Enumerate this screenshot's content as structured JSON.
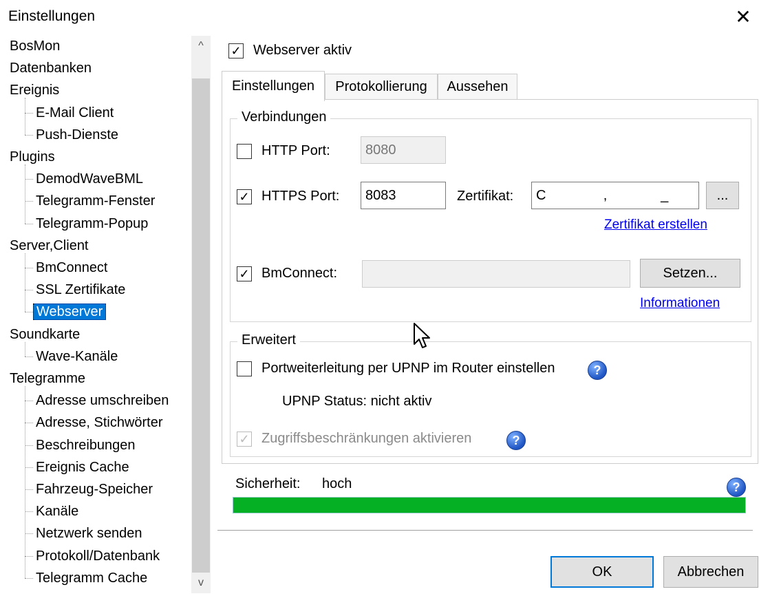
{
  "window": {
    "title": "Einstellungen",
    "close_symbol": "✕"
  },
  "tree": {
    "items": [
      {
        "label": "BosMon",
        "level": 0
      },
      {
        "label": "Datenbanken",
        "level": 0
      },
      {
        "label": "Ereignis",
        "level": 0
      },
      {
        "label": "E-Mail Client",
        "level": 1
      },
      {
        "label": "Push-Dienste",
        "level": 1
      },
      {
        "label": "Plugins",
        "level": 0
      },
      {
        "label": "DemodWaveBML",
        "level": 1
      },
      {
        "label": "Telegramm-Fenster",
        "level": 1
      },
      {
        "label": "Telegramm-Popup",
        "level": 1
      },
      {
        "label": "Server,Client",
        "level": 0
      },
      {
        "label": "BmConnect",
        "level": 1
      },
      {
        "label": "SSL Zertifikate",
        "level": 1
      },
      {
        "label": "Webserver",
        "level": 1,
        "selected": true
      },
      {
        "label": "Soundkarte",
        "level": 0
      },
      {
        "label": "Wave-Kanäle",
        "level": 1
      },
      {
        "label": "Telegramme",
        "level": 0
      },
      {
        "label": "Adresse umschreiben",
        "level": 1
      },
      {
        "label": "Adresse, Stichwörter",
        "level": 1
      },
      {
        "label": "Beschreibungen",
        "level": 1
      },
      {
        "label": "Ereignis Cache",
        "level": 1
      },
      {
        "label": "Fahrzeug-Speicher",
        "level": 1
      },
      {
        "label": "Kanäle",
        "level": 1
      },
      {
        "label": "Netzwerk senden",
        "level": 1
      },
      {
        "label": "Protokoll/Datenbank",
        "level": 1
      },
      {
        "label": "Telegramm Cache",
        "level": 1
      }
    ],
    "scroll_up": "^",
    "scroll_down": "v"
  },
  "webserver_active": {
    "label": "Webserver aktiv",
    "checked": true
  },
  "tabs": [
    {
      "label": "Einstellungen",
      "active": true
    },
    {
      "label": "Protokollierung",
      "active": false
    },
    {
      "label": "Aussehen",
      "active": false
    }
  ],
  "verbindungen": {
    "title": "Verbindungen",
    "http": {
      "label": "HTTP Port:",
      "checked": false,
      "value": "8080"
    },
    "https": {
      "label": "HTTPS Port:",
      "checked": true,
      "value": "8083"
    },
    "zertifikat": {
      "label": "Zertifikat:",
      "value": "C               ,              _",
      "browse_label": "..."
    },
    "zertifikat_link": "Zertifikat erstellen",
    "bmconnect": {
      "label": "BmConnect:",
      "checked": true,
      "value": "",
      "button_label": "Setzen..."
    },
    "info_link": "Informationen"
  },
  "erweitert": {
    "title": "Erweitert",
    "upnp": {
      "label": "Portweiterleitung per UPNP im Router einstellen",
      "checked": false
    },
    "upnp_status": "UPNP Status: nicht aktiv",
    "access": {
      "label": "Zugriffsbeschränkungen aktivieren",
      "checked": true,
      "disabled": true
    }
  },
  "security": {
    "label": "Sicherheit:",
    "value": "hoch",
    "level_fraction": 1.0,
    "bar_color": "#06b025"
  },
  "buttons": {
    "ok": "OK",
    "cancel": "Abbrechen"
  },
  "icons": {
    "help": "?",
    "check": "✓"
  }
}
